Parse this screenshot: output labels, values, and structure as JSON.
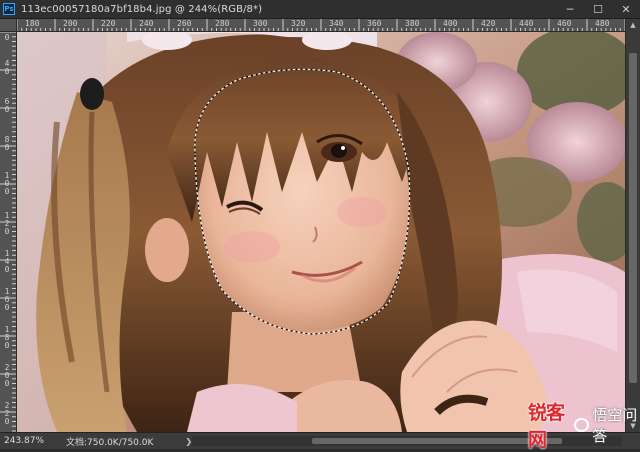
{
  "window": {
    "app_icon_letters": "Ps",
    "title": "113ec00057180a7bf18b4.jpg @ 244%(RGB/8*)",
    "controls": {
      "minimize": "─",
      "maximize": "☐",
      "close": "✕"
    }
  },
  "ruler": {
    "horizontal": [
      "180",
      "200",
      "220",
      "240",
      "260",
      "280",
      "300",
      "320",
      "340",
      "360",
      "380",
      "400",
      "420",
      "440",
      "460",
      "480"
    ],
    "vertical": [
      "0",
      "40",
      "60",
      "80",
      "100",
      "120",
      "140",
      "160",
      "180",
      "200",
      "220"
    ]
  },
  "scrollbar": {
    "up": "▲",
    "down": "▼"
  },
  "status": {
    "zoom": "243.87%",
    "doc_info": "文档:750.0K/750.0K",
    "arrow": "❯"
  },
  "watermark": {
    "brand": "锐客网",
    "sub": "悟空问答"
  },
  "tool": {
    "name": "marquee-selection",
    "selection_shape": "face"
  },
  "colors": {
    "titlebar": "#2f2f2f",
    "ruler": "#535353",
    "watermark_red": "#e0262f"
  }
}
